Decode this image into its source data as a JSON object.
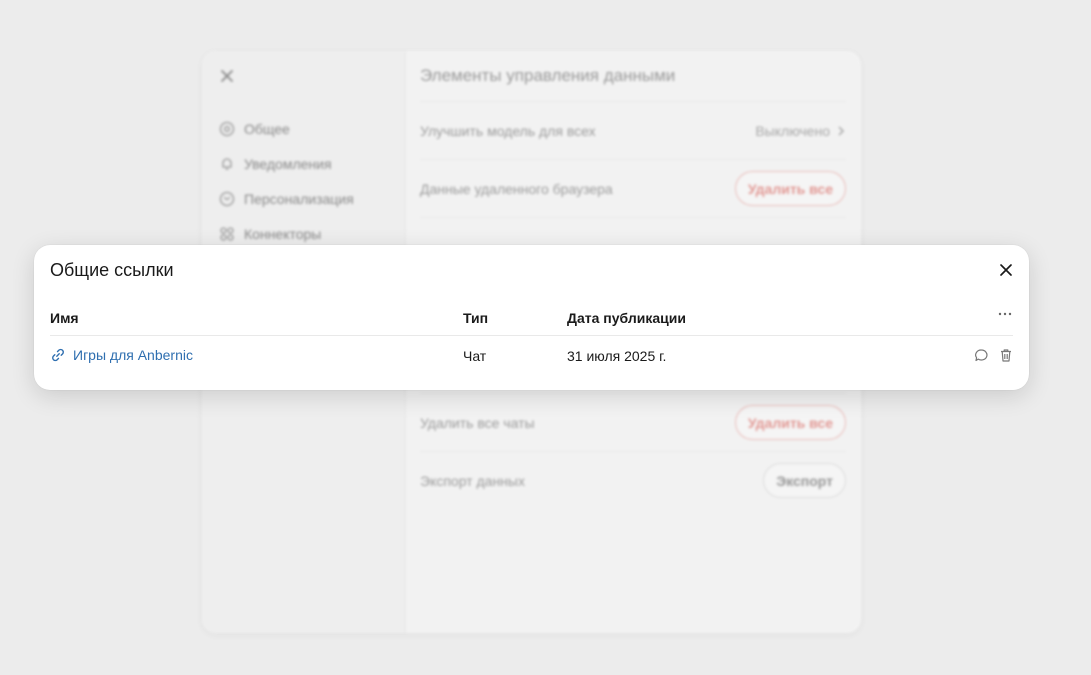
{
  "background": {
    "sidebar": {
      "items": [
        {
          "label": "Общее",
          "icon": "gear-icon"
        },
        {
          "label": "Уведомления",
          "icon": "bell-icon"
        },
        {
          "label": "Персонализация",
          "icon": "personalization-icon"
        },
        {
          "label": "Коннекторы",
          "icon": "connectors-icon"
        }
      ]
    },
    "main": {
      "title": "Элементы управления данными",
      "rows": [
        {
          "label": "Улучшить модель для всех",
          "value": "Выключено"
        },
        {
          "label": "Данные удаленного браузера",
          "button": "Удалить все"
        },
        {
          "label": "Удалить все чаты",
          "button": "Удалить все"
        },
        {
          "label": "Экспорт данных",
          "button": "Экспорт"
        }
      ]
    }
  },
  "dialog": {
    "title": "Общие ссылки",
    "columns": {
      "name": "Имя",
      "type": "Тип",
      "date": "Дата публикации"
    },
    "rows": [
      {
        "name": "Игры для Anbernic",
        "type": "Чат",
        "date": "31 июля 2025 г."
      }
    ]
  },
  "colors": {
    "link": "#2f6fb0",
    "danger": "#e08a85",
    "backdrop": "#ececec"
  }
}
